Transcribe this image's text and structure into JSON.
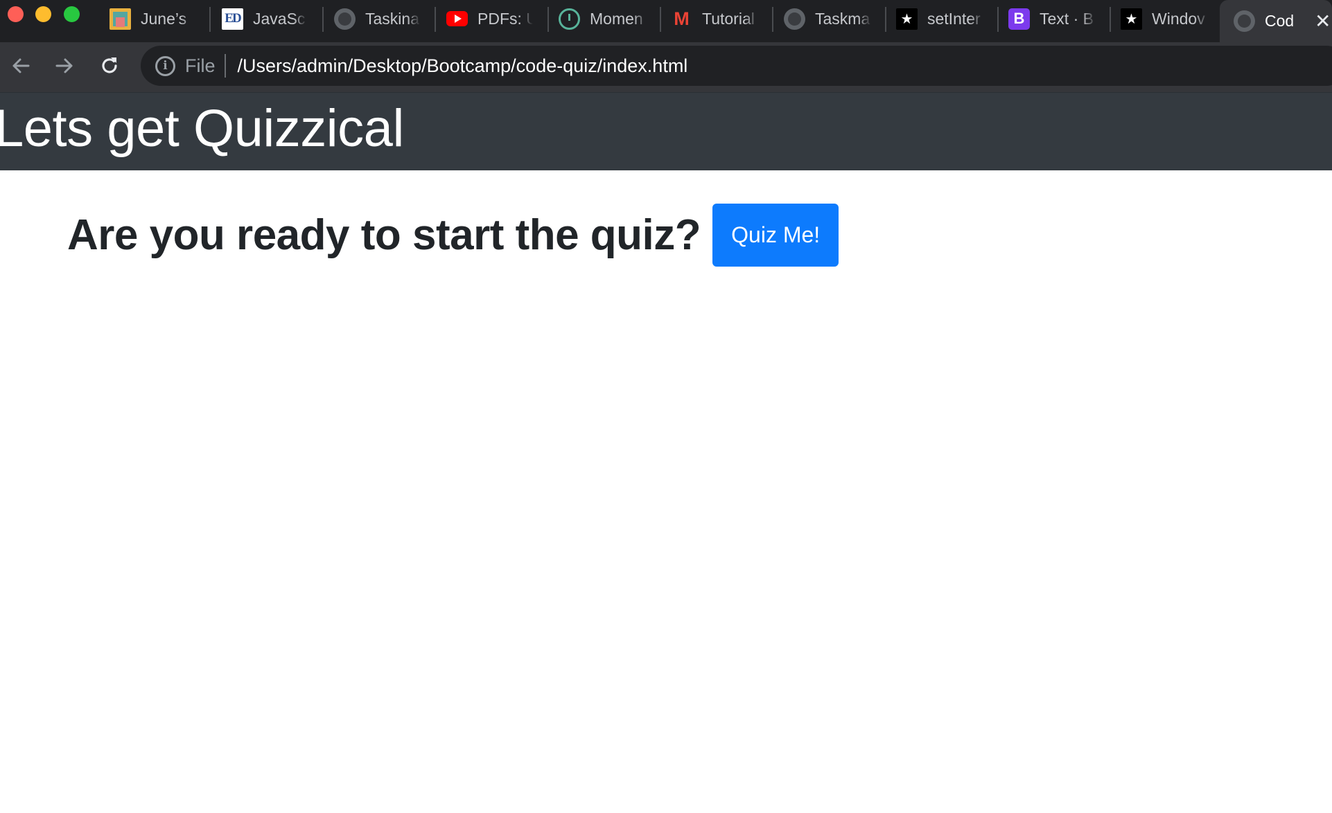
{
  "tabs": [
    {
      "label": "June’s",
      "icon": "gallery-icon"
    },
    {
      "label": "JavaSc",
      "icon": "ed-icon"
    },
    {
      "label": "Taskina",
      "icon": "globe-icon"
    },
    {
      "label": "PDFs: U",
      "icon": "youtube-icon"
    },
    {
      "label": "Momen",
      "icon": "clock-icon"
    },
    {
      "label": "Tutorial",
      "icon": "gmail-icon"
    },
    {
      "label": "Taskma",
      "icon": "globe-icon"
    },
    {
      "label": "setInter",
      "icon": "dev-icon"
    },
    {
      "label": "Text · B",
      "icon": "bootstrap-icon"
    },
    {
      "label": "Windov",
      "icon": "dev-icon"
    }
  ],
  "active_tab": {
    "label": "Cod",
    "icon": "globe-icon",
    "close_glyph": "✕"
  },
  "toolbar": {
    "scheme_label": "File",
    "url": "/Users/admin/Desktop/Bootcamp/code-quiz/index.html"
  },
  "page": {
    "site_title": "Lets get Quizzical",
    "prompt": "Are you ready to start the quiz?",
    "start_button_label": "Quiz Me!"
  },
  "colors": {
    "tab_strip": "#1f2023",
    "toolbar": "#35363a",
    "omnibox": "#202124",
    "jumbotron": "#343a40",
    "primary_button": "#0d7bfd",
    "body_text": "#212529"
  }
}
